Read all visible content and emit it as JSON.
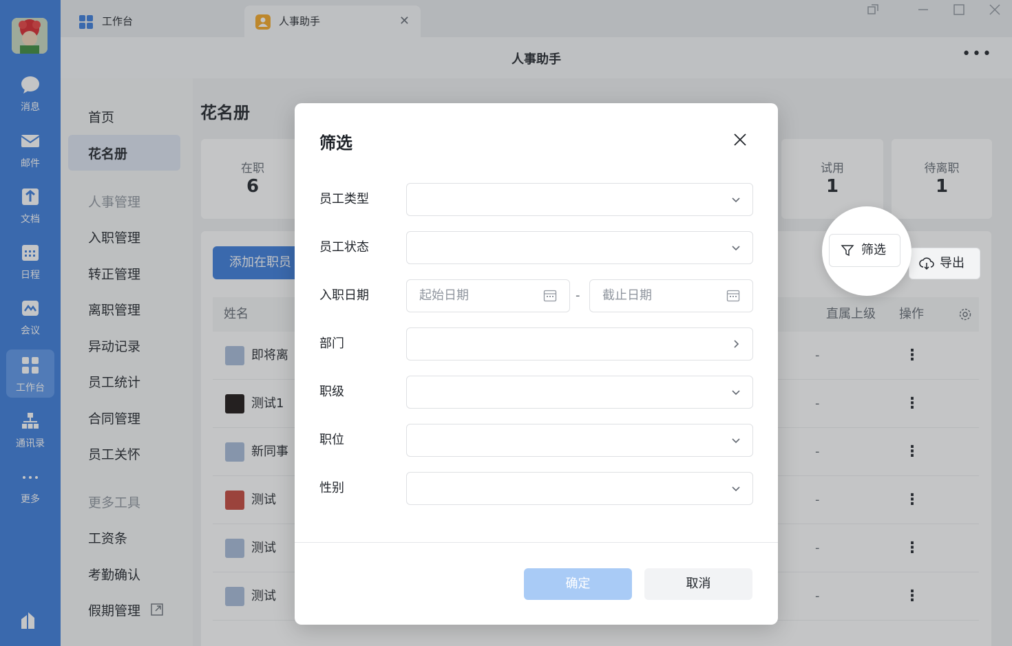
{
  "rail": {
    "items": [
      {
        "label": "消息",
        "icon": "chat-icon"
      },
      {
        "label": "邮件",
        "icon": "mail-icon"
      },
      {
        "label": "文档",
        "icon": "doc-icon"
      },
      {
        "label": "日程",
        "icon": "calendar-icon"
      },
      {
        "label": "会议",
        "icon": "meeting-icon"
      },
      {
        "label": "工作台",
        "icon": "workbench-icon"
      },
      {
        "label": "通讯录",
        "icon": "contacts-icon"
      },
      {
        "label": "更多",
        "icon": "more-icon"
      }
    ],
    "active": "工作台"
  },
  "tabs": [
    {
      "label": "工作台",
      "icon": "grid-icon"
    },
    {
      "label": "人事助手",
      "icon": "hr-assistant-icon",
      "active": true
    }
  ],
  "app": {
    "title": "人事助手"
  },
  "sidebar": {
    "home": "首页",
    "roster": "花名册",
    "group_hr": "人事管理",
    "onboarding": "入职管理",
    "regularization": "转正管理",
    "offboarding": "离职管理",
    "changes": "异动记录",
    "stats": "员工统计",
    "contracts": "合同管理",
    "care": "员工关怀",
    "group_tools": "更多工具",
    "payslip": "工资条",
    "attendance": "考勤确认",
    "leave": "假期管理"
  },
  "page": {
    "title": "花名册",
    "stats": [
      {
        "label": "在职",
        "value": "6"
      },
      {
        "label": "试用",
        "value": "1"
      },
      {
        "label": "待离职",
        "value": "1"
      }
    ],
    "add_button": "添加在职员",
    "filter_button": "筛选",
    "export_button": "导出",
    "table": {
      "col_name": "姓名",
      "col_supervisor": "直属上级",
      "col_actions": "操作",
      "rows": [
        {
          "name": "即将离",
          "supervisor": "-",
          "actions": "⋮"
        },
        {
          "name": "测试1",
          "supervisor": "-",
          "actions": "⋮"
        },
        {
          "name": "新同事",
          "supervisor": "-",
          "actions": "⋮"
        },
        {
          "name": "测试",
          "supervisor": "-",
          "actions": "⋮"
        },
        {
          "name": "测试",
          "supervisor": "-",
          "actions": "⋮"
        },
        {
          "name": "测试",
          "supervisor": "-",
          "actions": "⋮"
        }
      ]
    }
  },
  "modal": {
    "title": "筛选",
    "fields": {
      "employee_type": "员工类型",
      "employee_status": "员工状态",
      "hire_date": "入职日期",
      "department": "部门",
      "rank": "职级",
      "position": "职位",
      "gender": "性别"
    },
    "date_start_placeholder": "起始日期",
    "date_end_placeholder": "截止日期",
    "date_separator": "-",
    "confirm": "确定",
    "cancel": "取消"
  },
  "colors": {
    "rail": "#3a7bdb",
    "accent": "#3a7bdb",
    "confirm_disabled": "#a9cbf6"
  }
}
